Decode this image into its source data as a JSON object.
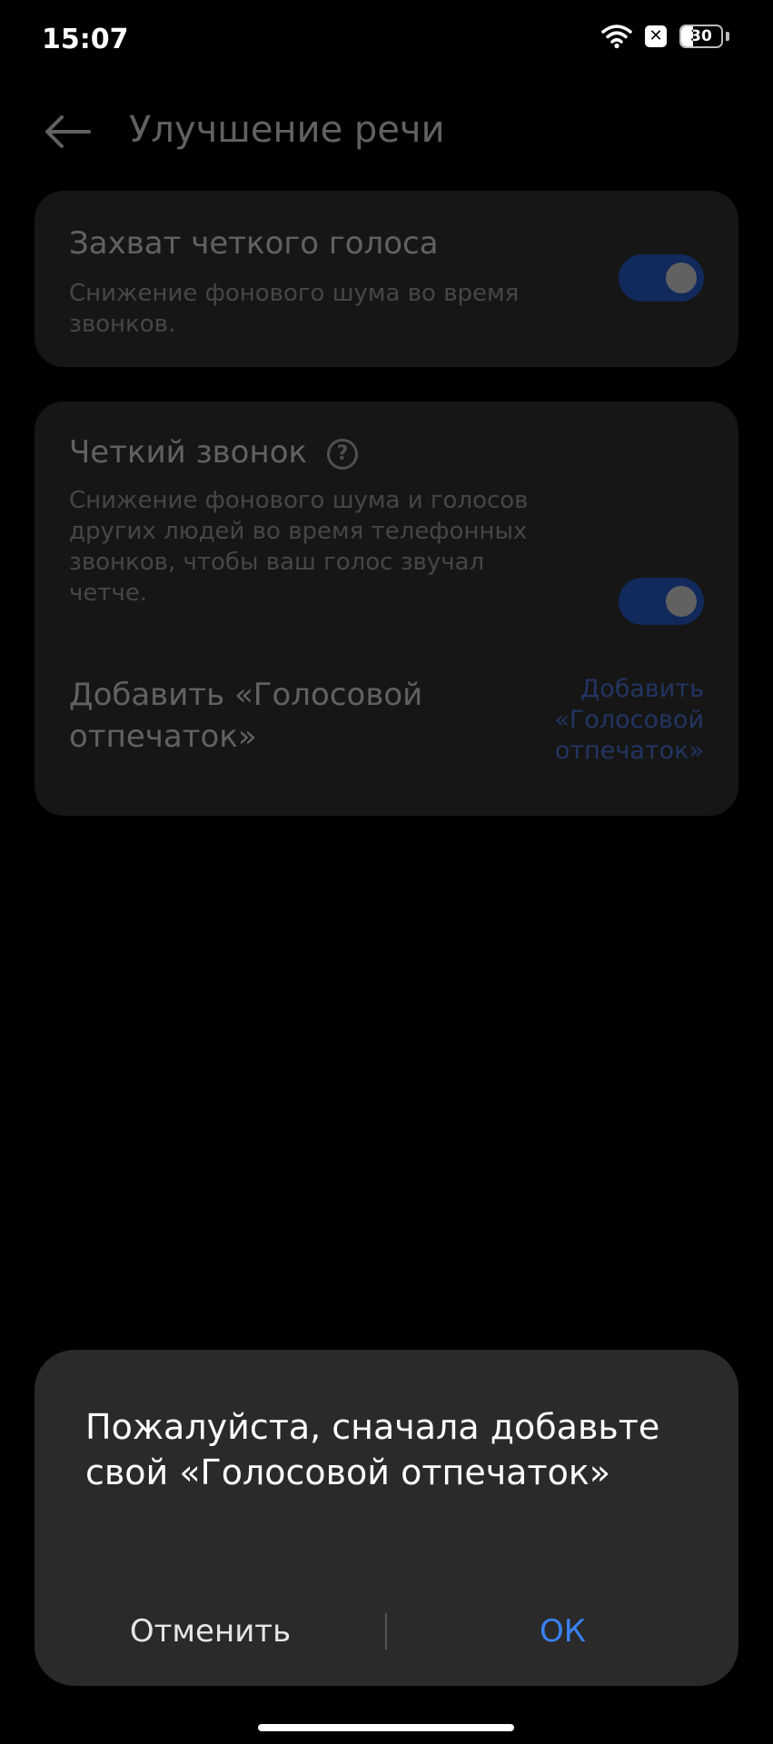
{
  "status_bar": {
    "time": "15:07",
    "battery_level": "30",
    "icons": [
      "wifi-icon",
      "sim-x-icon",
      "battery-icon"
    ]
  },
  "header": {
    "title": "Улучшение речи",
    "back_icon": "arrow-left-icon"
  },
  "settings": {
    "clear_voice": {
      "title": "Захват четкого голоса",
      "subtitle": "Снижение фонового шума во время звонков.",
      "enabled": true
    },
    "clear_call": {
      "title": "Четкий звонок",
      "subtitle": "Снижение фонового шума и голосов других людей во время телефонных звонков, чтобы ваш голос звучал четче.",
      "enabled": true,
      "help_icon": "question-circle-icon"
    },
    "voiceprint": {
      "label": "Добавить «Голосовой отпечаток»",
      "link": "Добавить «Голосовой отпечаток»"
    }
  },
  "dialog": {
    "message": "Пожалуйста, сначала добавьте свой «Голосовой отпечаток»",
    "cancel_label": "Отменить",
    "ok_label": "ОК"
  },
  "colors": {
    "accent": "#3b82f6",
    "toggle_on": "#2e6cf0",
    "card": "#3a3a3a",
    "dialog": "#2a2a2a"
  }
}
